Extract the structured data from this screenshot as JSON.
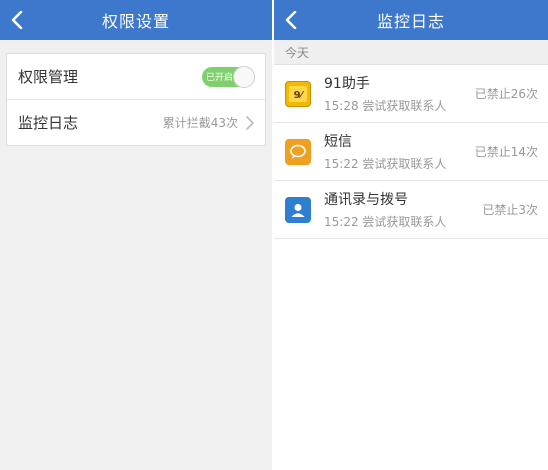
{
  "left": {
    "title": "权限设置",
    "rows": [
      {
        "label": "权限管理",
        "toggle_text": "已开启",
        "toggle_on": true
      },
      {
        "label": "监控日志",
        "value": "累计拦截43次"
      }
    ]
  },
  "right": {
    "title": "监控日志",
    "section": "今天",
    "items": [
      {
        "name": "91助手",
        "desc": "15:28 尝试获取联系人",
        "status": "已禁止26次",
        "icon": "91-assistant-icon"
      },
      {
        "name": "短信",
        "desc": "15:22 尝试获取联系人",
        "status": "已禁止14次",
        "icon": "sms-icon"
      },
      {
        "name": "通讯录与拨号",
        "desc": "15:22 尝试获取联系人",
        "status": "已禁止3次",
        "icon": "contacts-icon"
      }
    ]
  },
  "colors": {
    "titlebar": "#3d78cc",
    "toggle_on": "#7fd06d",
    "sms_icon": "#f0a020",
    "contacts_icon": "#2f7fd0",
    "91_icon_bg": "#f5b800"
  }
}
